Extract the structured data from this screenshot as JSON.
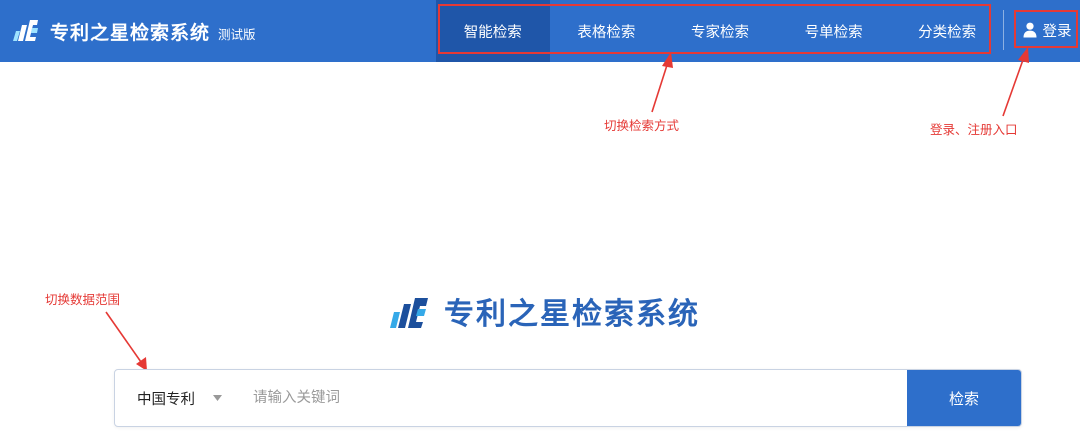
{
  "header": {
    "brand_title": "专利之星检索系统",
    "brand_sub": "测试版",
    "nav": [
      {
        "label": "智能检索",
        "active": true
      },
      {
        "label": "表格检索"
      },
      {
        "label": "专家检索"
      },
      {
        "label": "号单检索"
      },
      {
        "label": "分类检索"
      }
    ],
    "login_label": "登录"
  },
  "annotations": {
    "switch_search_mode": "切换检索方式",
    "login_register": "登录、注册入口",
    "switch_data_scope": "切换数据范围"
  },
  "center": {
    "title": "专利之星检索系统"
  },
  "search": {
    "scope_value": "中国专利",
    "placeholder": "请输入关键词",
    "button_label": "检索"
  },
  "colors": {
    "primary": "#2e6fcb",
    "nav_active": "#1f56a9",
    "annotation": "#e53935",
    "title_blue": "#2a64b8"
  },
  "icons": {
    "brand": "brand-logo-icon",
    "login": "user-icon",
    "scope": "caret-down-icon"
  }
}
